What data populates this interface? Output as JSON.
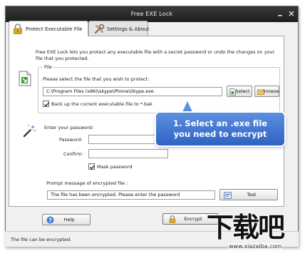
{
  "window": {
    "title": "Free EXE Lock"
  },
  "tabs": [
    {
      "label": "Protect Executable File"
    },
    {
      "label": "Settings & About"
    }
  ],
  "description": "Free EXE Lock lets you protect any executable file with a secret password or undo the changes on your file that you protected.",
  "file_group": {
    "title": "File",
    "prompt": "Please select the file that you wish to protect:",
    "path_value": "C:\\Program Files (x86)\\skype\\Phone\\Skype.exe",
    "select_label": "Select",
    "browse_label": "Browse",
    "backup_label": "Back up the current executable file to *.bak",
    "backup_checked": true
  },
  "password_section": {
    "heading": "Enter your password:",
    "password_label": "Password:",
    "password_value": "",
    "confirm_label": "Confirm:",
    "confirm_value": "",
    "mask_label": "Mask password",
    "mask_checked": true
  },
  "prompt_section": {
    "heading": "Prompt message of encrypted file :",
    "message_value": "The file has been encrypted. Please enter the password",
    "test_label": "Test"
  },
  "footer": {
    "help_label": "Help",
    "encrypt_label": "Encrypt"
  },
  "status": {
    "text": "The file can be encrypted."
  },
  "callout": {
    "line1": "1. Select an .exe file",
    "line2": "you need to encrypt"
  },
  "watermark": {
    "chars": "下载吧",
    "url": "www.xiazaiba.com"
  },
  "colors": {
    "titlebar": "#1d1d1d",
    "callout": "#3a6fd0",
    "accent_green": "#3fa535",
    "lock_gold": "#e0a82a"
  }
}
